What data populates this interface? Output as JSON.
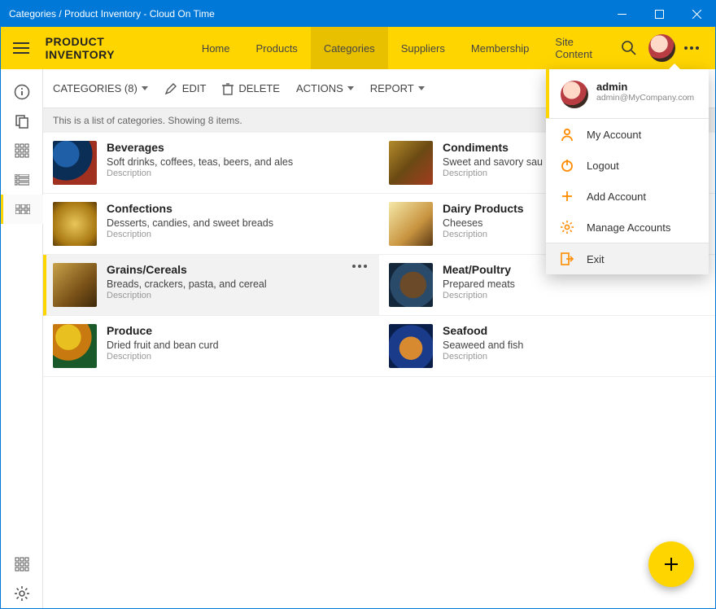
{
  "window": {
    "title": "Categories / Product Inventory - Cloud On Time"
  },
  "header": {
    "brand": "PRODUCT INVENTORY",
    "nav": [
      {
        "label": "Home"
      },
      {
        "label": "Products"
      },
      {
        "label": "Categories",
        "active": true
      },
      {
        "label": "Suppliers"
      },
      {
        "label": "Membership"
      },
      {
        "label": "Site Content"
      }
    ]
  },
  "toolbar": {
    "categories_label": "CATEGORIES (8)",
    "edit": "EDIT",
    "delete": "DELETE",
    "actions": "ACTIONS",
    "report": "REPORT"
  },
  "info": "This is a list of categories. Showing 8 items.",
  "items": [
    {
      "title": "Beverages",
      "subtitle": "Soft drinks, coffees, teas, beers, and ales",
      "desc": "Description",
      "thumb": "t-bev"
    },
    {
      "title": "Condiments",
      "subtitle": "Sweet and savory sau",
      "desc": "Description",
      "thumb": "t-cond"
    },
    {
      "title": "Confections",
      "subtitle": "Desserts, candies, and sweet breads",
      "desc": "Description",
      "thumb": "t-conf"
    },
    {
      "title": "Dairy Products",
      "subtitle": "Cheeses",
      "desc": "Description",
      "thumb": "t-dair"
    },
    {
      "title": "Grains/Cereals",
      "subtitle": "Breads, crackers, pasta, and cereal",
      "desc": "Description",
      "thumb": "t-grai",
      "selected": true
    },
    {
      "title": "Meat/Poultry",
      "subtitle": "Prepared meats",
      "desc": "Description",
      "thumb": "t-meat"
    },
    {
      "title": "Produce",
      "subtitle": "Dried fruit and bean curd",
      "desc": "Description",
      "thumb": "t-prod"
    },
    {
      "title": "Seafood",
      "subtitle": "Seaweed and fish",
      "desc": "Description",
      "thumb": "t-sea"
    }
  ],
  "user_menu": {
    "name": "admin",
    "email": "admin@MyCompany.com",
    "entries": [
      {
        "label": "My Account",
        "icon": "person"
      },
      {
        "label": "Logout",
        "icon": "power"
      },
      {
        "label": "Add Account",
        "icon": "plus"
      },
      {
        "label": "Manage Accounts",
        "icon": "gear"
      },
      {
        "label": "Exit",
        "icon": "exit",
        "hover": true
      }
    ]
  }
}
